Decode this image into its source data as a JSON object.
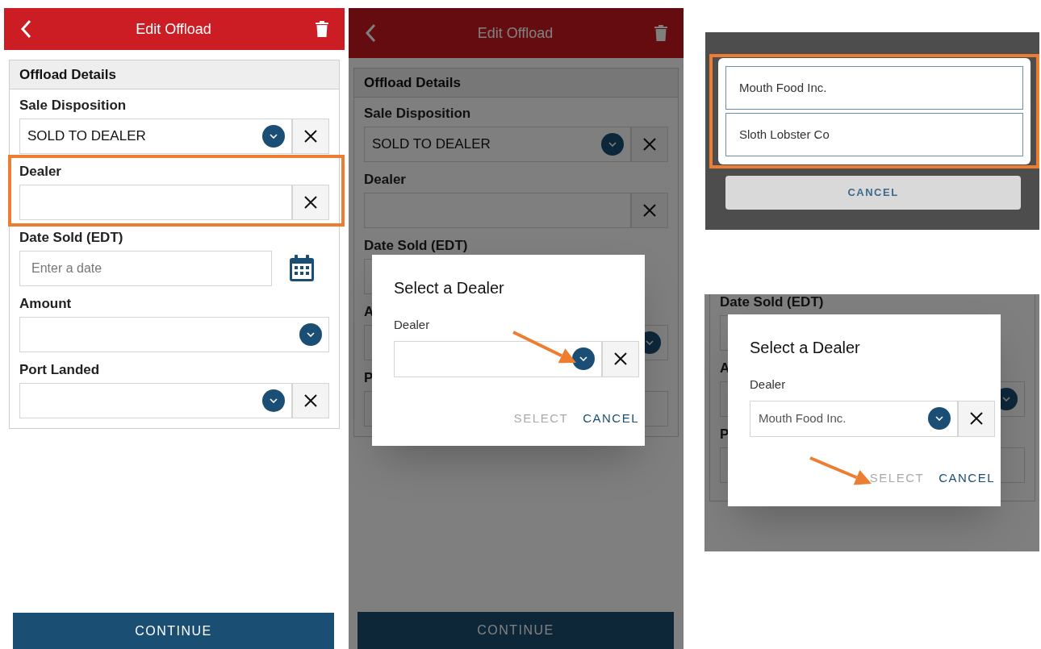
{
  "form_screen": {
    "header": {
      "title": "Edit Offload"
    },
    "section_title": "Offload Details",
    "fields": [
      {
        "kind": "select",
        "label": "Sale Disposition",
        "value": "SOLD TO DEALER",
        "dropdown": true,
        "clearable": true,
        "highlighted": false
      },
      {
        "kind": "select",
        "label": "Dealer",
        "dropdown": false,
        "clearable": true,
        "highlighted": true
      },
      {
        "kind": "date",
        "label": "Date Sold (EDT)",
        "placeholder": "Enter a date",
        "calendar": true,
        "highlighted": false
      },
      {
        "kind": "select",
        "label": "Amount",
        "dropdown": true,
        "clearable": false,
        "highlighted": false
      },
      {
        "kind": "select",
        "label": "Port Landed",
        "dropdown": true,
        "clearable": true,
        "highlighted": false
      }
    ],
    "continue_button": "CONTINUE"
  },
  "dialog_screen": {
    "header": {
      "title": "Edit Offload"
    },
    "section_title": "Offload Details",
    "fields": [
      {
        "kind": "select",
        "label": "Sale Disposition",
        "value": "SOLD TO DEALER",
        "dropdown": true,
        "clearable": true
      },
      {
        "kind": "select",
        "label": "Dealer",
        "dropdown": false,
        "clearable": true
      },
      {
        "kind": "date",
        "label": "Date Sold (EDT)"
      },
      {
        "kind": "select",
        "label": "A",
        "dropdown": true,
        "clearable": false
      },
      {
        "kind": "select",
        "label": "P"
      }
    ],
    "continue_button": "CONTINUE",
    "dialog": {
      "title": "Select a Dealer",
      "field_label": "Dealer",
      "annotation_arrow": {
        "kind": "dropdown"
      },
      "actions": [
        {
          "label": "SELECT",
          "disabled": true
        },
        {
          "label": "CANCEL",
          "disabled": false
        }
      ]
    }
  },
  "dealer_picker": {
    "highlighted": true,
    "options": [
      "Mouth Food Inc.",
      "Sloth Lobster Co"
    ],
    "cancel": "CANCEL"
  },
  "selected_screen": {
    "fields": [
      {
        "kind": "date",
        "label": "Date Sold (EDT)"
      },
      {
        "kind": "select",
        "label": "A",
        "dropdown": true,
        "clearable": false
      },
      {
        "kind": "select",
        "label": "P"
      }
    ],
    "dialog": {
      "title": "Select a Dealer",
      "field_label": "Dealer",
      "value": "Mouth Food Inc.",
      "annotation_arrow": {
        "kind": "select"
      },
      "actions": [
        {
          "label": "SELECT",
          "disabled": true
        },
        {
          "label": "CANCEL",
          "disabled": false
        }
      ]
    }
  }
}
